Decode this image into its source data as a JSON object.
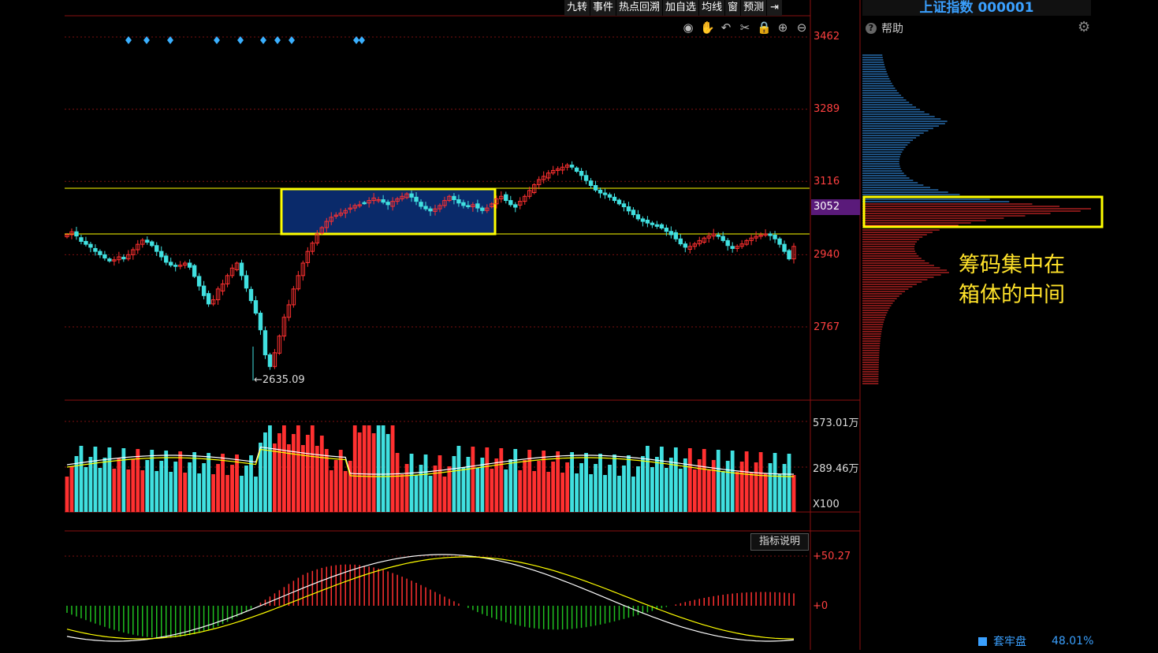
{
  "toolbar": {
    "items": [
      "九转",
      "事件",
      "热点回溯",
      "加自选",
      "均线",
      "窗",
      "预测"
    ],
    "collapse_icon": "arrow-right-bar-icon"
  },
  "chart_tools": [
    "eye-icon",
    "hand-icon",
    "undo-icon",
    "scissors-icon",
    "lock-icon",
    "zoom-in-icon",
    "zoom-out-icon"
  ],
  "right_panel": {
    "title": "上证指数 000001",
    "help": "帮助",
    "help_icon": "question-icon",
    "settings_icon": "gear-icon",
    "annotation_line1": "筹码集中在",
    "annotation_line2": "箱体的中间",
    "legend_label": "套牢盘",
    "legend_value": "48.01%"
  },
  "price_axis": {
    "ticks": [
      "3462",
      "3289",
      "3116",
      "3052",
      "2940",
      "2767"
    ],
    "highlight": "3052",
    "low_label": "2635.09"
  },
  "volume_axis": {
    "top": "573.01万",
    "mid": "289.46万",
    "unit": "X100"
  },
  "macd_axis": {
    "top": "+50.27",
    "zero": "+0"
  },
  "indicator_button": "指标说明",
  "colors": {
    "up": "#ff3030",
    "down": "#40e0e0",
    "box_line": "#ffff00",
    "box_fill": "#0a2a6a",
    "grid": "#7a1010",
    "chip_upper": "#3aa0ff",
    "chip_lower": "#ff3030",
    "annotation": "#ffe22a"
  },
  "chart_data": {
    "type": "candlestick",
    "x_count": 155,
    "price_low": 2635.09,
    "box_range": [
      3005,
      3112
    ],
    "close": [
      2988,
      2995,
      2985,
      2972,
      2965,
      2958,
      2948,
      2940,
      2932,
      2925,
      2928,
      2935,
      2930,
      2940,
      2952,
      2965,
      2975,
      2970,
      2962,
      2948,
      2935,
      2922,
      2915,
      2912,
      2915,
      2920,
      2910,
      2888,
      2865,
      2842,
      2822,
      2832,
      2858,
      2870,
      2890,
      2908,
      2920,
      2890,
      2860,
      2830,
      2800,
      2760,
      2700,
      2672,
      2705,
      2745,
      2790,
      2820,
      2858,
      2890,
      2920,
      2948,
      2968,
      2990,
      3005,
      3020,
      3030,
      3035,
      3040,
      3046,
      3052,
      3058,
      3060,
      3064,
      3070,
      3076,
      3072,
      3066,
      3060,
      3068,
      3074,
      3080,
      3086,
      3078,
      3068,
      3056,
      3050,
      3045,
      3050,
      3058,
      3070,
      3080,
      3072,
      3064,
      3058,
      3055,
      3060,
      3052,
      3046,
      3052,
      3062,
      3074,
      3080,
      3070,
      3060,
      3054,
      3068,
      3080,
      3094,
      3108,
      3120,
      3128,
      3136,
      3142,
      3146,
      3150,
      3155,
      3150,
      3140,
      3130,
      3118,
      3106,
      3095,
      3088,
      3084,
      3078,
      3070,
      3062,
      3055,
      3045,
      3036,
      3026,
      3020,
      3016,
      3012,
      3008,
      3004,
      2996,
      2988,
      2978,
      2966,
      2958,
      2960,
      2966,
      2974,
      2980,
      2985,
      2990,
      2984,
      2974,
      2962,
      2955,
      2960,
      2966,
      2974,
      2980,
      2984,
      2987,
      2990,
      2986,
      2978,
      2965,
      2948,
      2930,
      2960
    ],
    "ma_white": [
      2990,
      2985,
      2978,
      2968,
      2958,
      2948,
      2938,
      2930,
      2925,
      2922,
      2930,
      2938,
      2945,
      2950,
      2948,
      2940,
      2930,
      2920,
      2912,
      2905,
      2895,
      2880,
      2862,
      2840,
      2820,
      2818,
      2830,
      2848,
      2862,
      2870,
      2860,
      2840,
      2810,
      2780,
      2760,
      2770,
      2800,
      2850,
      2900,
      2940,
      2975,
      3000,
      3018,
      3032,
      3044,
      3052,
      3060,
      3066,
      3068,
      3066,
      3062,
      3060,
      3062,
      3064,
      3062,
      3060,
      3060,
      3063,
      3068,
      3070,
      3072,
      3080,
      3095,
      3110,
      3125,
      3135,
      3140,
      3140,
      3130,
      3115,
      3100,
      3088,
      3075,
      3064,
      3054,
      3042,
      3030,
      3018,
      3006,
      2995,
      2982,
      2970,
      2962,
      2958,
      2960,
      2966,
      2972,
      2975,
      2972,
      2966,
      2962,
      2962,
      2966,
      2972,
      2975,
      2976,
      2972,
      2966
    ],
    "vol_up_color": "#ff3030",
    "vol_down_color": "#40e0e0"
  }
}
